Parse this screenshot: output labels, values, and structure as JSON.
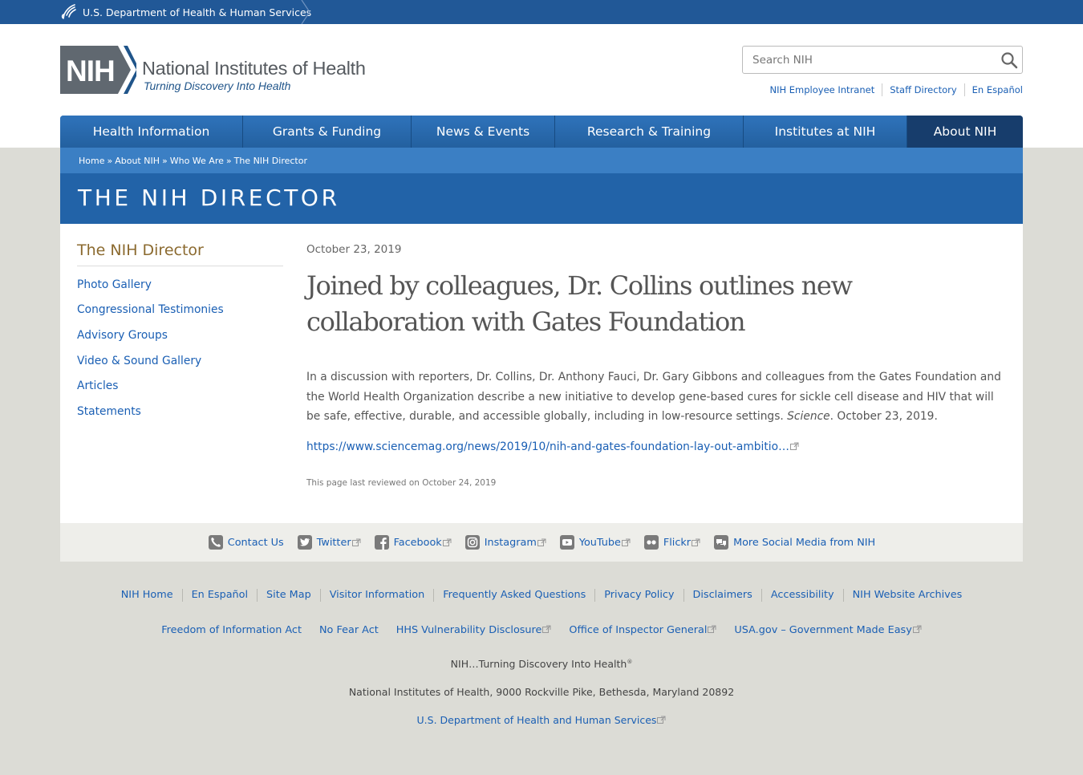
{
  "hhs": {
    "label": "U.S. Department of Health & Human Services"
  },
  "brand": {
    "abbr": "NIH",
    "name": "National Institutes of Health",
    "tagline": "Turning Discovery Into Health"
  },
  "search": {
    "placeholder": "Search NIH",
    "value": ""
  },
  "utility_links": [
    "NIH Employee Intranet",
    "Staff Directory",
    "En Español"
  ],
  "nav": [
    {
      "label": "Health Information",
      "active": false
    },
    {
      "label": "Grants & Funding",
      "active": false
    },
    {
      "label": "News & Events",
      "active": false
    },
    {
      "label": "Research & Training",
      "active": false
    },
    {
      "label": "Institutes at NIH",
      "active": false
    },
    {
      "label": "About NIH",
      "active": true
    }
  ],
  "breadcrumb": [
    "Home",
    "About NIH",
    "Who We Are",
    "The NIH Director"
  ],
  "banner_title": "THE NIH DIRECTOR",
  "sidebar": {
    "title": "The NIH Director",
    "items": [
      "Photo Gallery",
      "Congressional Testimonies",
      "Advisory Groups",
      "Video & Sound Gallery",
      "Articles",
      "Statements"
    ]
  },
  "article": {
    "date": "October 23, 2019",
    "headline": "Joined by colleagues, Dr. Collins outlines new collaboration with Gates Foundation",
    "body_before": "In a discussion with reporters, Dr. Collins, Dr. Anthony Fauci, Dr. Gary Gibbons and colleagues from the Gates Foundation and the World Health Organization describe a new initiative to develop gene-based cures for sickle cell disease and HIV that will be safe, effective, durable, and accessible globally, including in low-resource settings. ",
    "body_source": "Science",
    "body_after": ". October 23, 2019.",
    "link": "https://www.sciencemag.org/news/2019/10/nih-and-gates-foundation-lay-out-ambitio…",
    "reviewed": "This page last reviewed on October 24, 2019"
  },
  "social": [
    {
      "label": "Contact Us",
      "icon": "phone-icon",
      "external": false
    },
    {
      "label": "Twitter",
      "icon": "twitter-icon",
      "external": true
    },
    {
      "label": "Facebook",
      "icon": "facebook-icon",
      "external": true
    },
    {
      "label": "Instagram",
      "icon": "instagram-icon",
      "external": true
    },
    {
      "label": "YouTube",
      "icon": "youtube-icon",
      "external": true
    },
    {
      "label": "Flickr",
      "icon": "flickr-icon",
      "external": true
    },
    {
      "label": "More Social Media from NIH",
      "icon": "chat-icon",
      "external": false
    }
  ],
  "footer_links_1": [
    "NIH Home",
    "En Español",
    "Site Map",
    "Visitor Information",
    "Frequently Asked Questions",
    "Privacy Policy",
    "Disclaimers",
    "Accessibility",
    "NIH Website Archives"
  ],
  "footer_links_2": [
    {
      "label": "Freedom of Information Act",
      "external": false
    },
    {
      "label": "No Fear Act",
      "external": false
    },
    {
      "label": "HHS Vulnerability Disclosure",
      "external": true
    },
    {
      "label": "Office of Inspector General",
      "external": true
    },
    {
      "label": "USA.gov – Government Made Easy",
      "external": true
    }
  ],
  "footer_tagline": "NIH…Turning Discovery Into Health",
  "footer_tagline_mark": "®",
  "footer_address": "National Institutes of Health, 9000 Rockville Pike, Bethesda, Maryland 20892",
  "footer_hhs": "U.S. Department of Health and Human Services",
  "colors": {
    "hhs_bar": "#215897",
    "nav": "#2b6db3",
    "nav_active": "#173d6c",
    "banner": "#2263a8",
    "link": "#1a5fb4",
    "sidebar_title": "#8b6a2f"
  }
}
